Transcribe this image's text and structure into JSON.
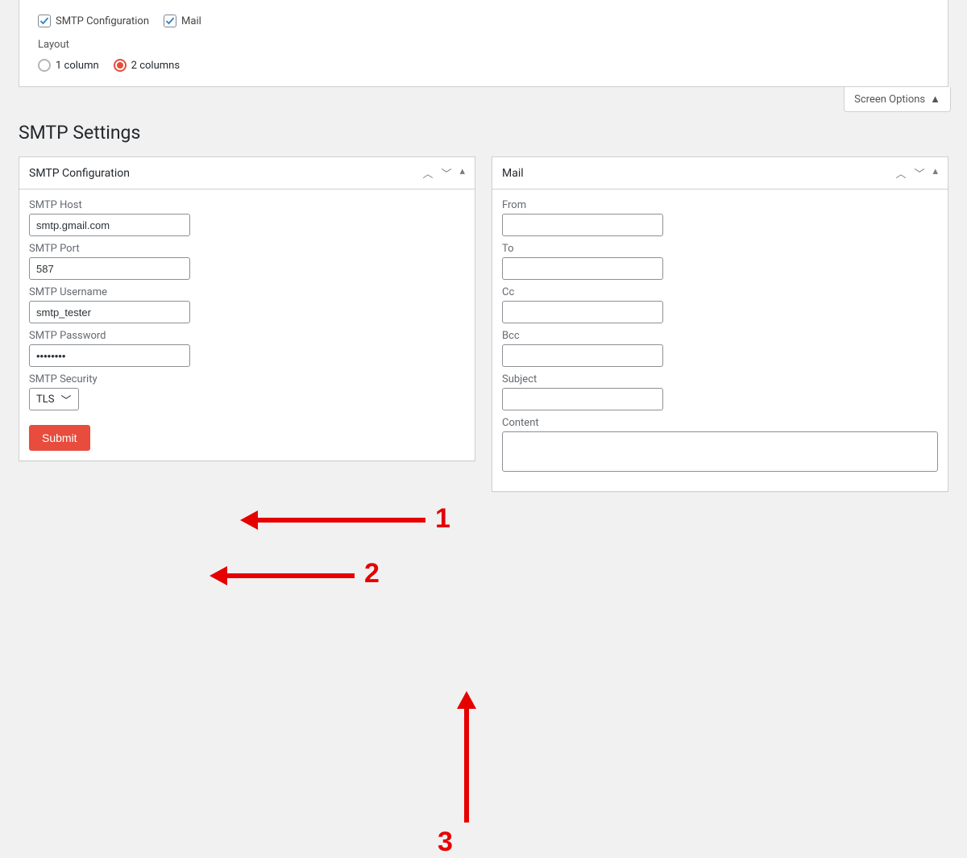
{
  "screen_options": {
    "checkboxes": {
      "smtp_config_label": "SMTP Configuration",
      "mail_label": "Mail"
    },
    "layout_label": "Layout",
    "layout_options": {
      "one_col": "1 column",
      "two_col": "2 columns"
    },
    "tab_label": "Screen Options"
  },
  "page": {
    "title": "SMTP Settings"
  },
  "panels": {
    "smtp": {
      "title": "SMTP Configuration",
      "fields": {
        "host_label": "SMTP Host",
        "host_value": "smtp.gmail.com",
        "port_label": "SMTP Port",
        "port_value": "587",
        "user_label": "SMTP Username",
        "user_value": "smtp_tester",
        "pass_label": "SMTP Password",
        "pass_value": "••••••••",
        "security_label": "SMTP Security",
        "security_value": "TLS"
      },
      "submit_label": "Submit"
    },
    "mail": {
      "title": "Mail",
      "fields": {
        "from_label": "From",
        "to_label": "To",
        "cc_label": "Cc",
        "bcc_label": "Bcc",
        "subject_label": "Subject",
        "content_label": "Content"
      }
    }
  },
  "annotations": {
    "a1": "1",
    "a2": "2",
    "a3": "3"
  }
}
